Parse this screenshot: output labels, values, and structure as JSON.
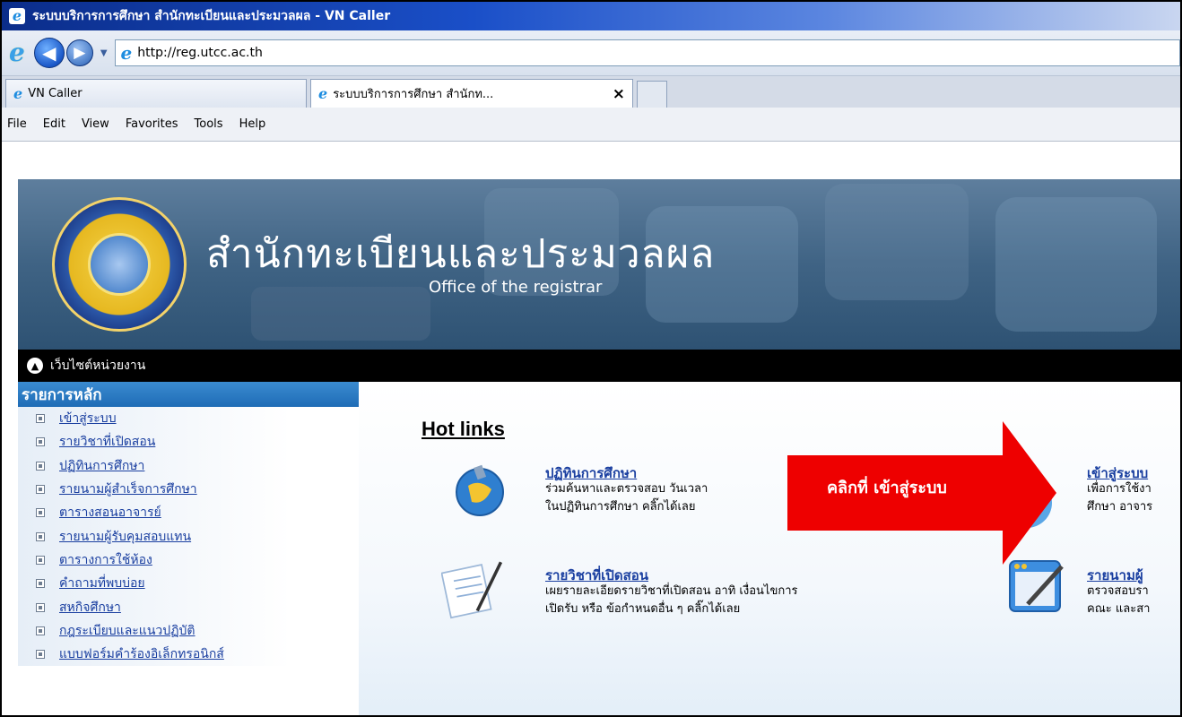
{
  "window": {
    "title": "ระบบบริการการศึกษา สำนักทะเบียนและประมวลผล - VN Caller"
  },
  "addressbar": {
    "url": "http://reg.utcc.ac.th"
  },
  "tabs": [
    {
      "label": "VN Caller"
    },
    {
      "label": "ระบบบริการการศึกษา สำนักท...",
      "close": "×"
    }
  ],
  "menu": [
    "File",
    "Edit",
    "View",
    "Favorites",
    "Tools",
    "Help"
  ],
  "banner": {
    "thai_title": "สำนักทะเบียนและประมวลผล",
    "english_title": "Office of the registrar"
  },
  "topbar": {
    "link_label": "เว็บไซต์หน่วยงาน"
  },
  "sidebar": {
    "header": "รายการหลัก",
    "items": [
      "เข้าสู่ระบบ",
      "รายวิชาที่เปิดสอน",
      "ปฏิทินการศึกษา",
      "รายนามผู้สำเร็จการศึกษา",
      "ตารางสอนอาจารย์",
      "รายนามผู้รับคุมสอบแทน",
      "ตารางการใช้ห้อง",
      "คำถามที่พบบ่อย",
      "สหกิจศึกษา",
      "กฎระเบียบและแนวปฏิบัติ",
      "แบบฟอร์มคำร้องอิเล็กทรอนิกส์"
    ]
  },
  "hotlinks": {
    "title": "Hot links",
    "cards": [
      {
        "title": "ปฏิทินการศึกษา",
        "line1": "ร่วมค้นหาและตรวจสอบ วันเวลา",
        "line2": "ในปฏิทินการศึกษา คลิ๊กได้เลย"
      },
      {
        "title": "เข้าสู่ระบบ",
        "line1": "เพื่อการใช้งา",
        "line2": "ศึกษา อาจาร"
      },
      {
        "title": "รายวิชาที่เปิดสอน",
        "line1": "เผยรายละเอียดรายวิชาที่เปิดสอน อาทิ เงื่อนไขการ",
        "line2": "เปิดรับ หรือ ข้อกำหนดอื่น ๆ คลิ๊กได้เลย"
      },
      {
        "title": "รายนามผู้",
        "line1": "ตรวจสอบรา",
        "line2": "คณะ และสา"
      }
    ]
  },
  "callout": {
    "text": "คลิกที่ เข้าสู่ระบบ",
    "color": "#ee0000"
  }
}
